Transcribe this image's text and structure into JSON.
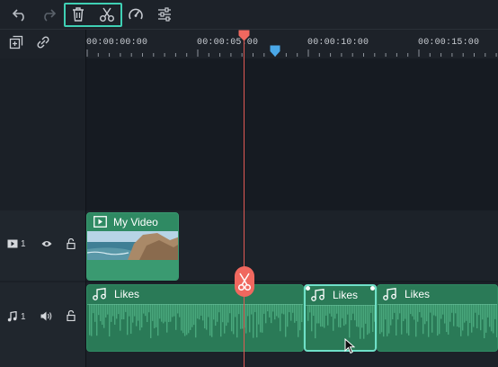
{
  "toolbar": {
    "buttons": [
      {
        "name": "undo-icon",
        "enabled": true
      },
      {
        "name": "redo-icon",
        "enabled": false
      },
      {
        "name": "delete-icon",
        "enabled": true
      },
      {
        "name": "scissors-icon",
        "enabled": true
      },
      {
        "name": "speed-icon",
        "enabled": true
      },
      {
        "name": "adjust-icon",
        "enabled": true
      }
    ],
    "highlight_color": "#3fd0b4"
  },
  "left_tools": [
    "add-track-icon",
    "link-icon"
  ],
  "ruler": {
    "labels": [
      "00:00:00:00",
      "00:00:05:00",
      "00:00:10:00",
      "00:00:15:00"
    ]
  },
  "tracks": {
    "video": {
      "number": "1",
      "icons": [
        "video-track-icon",
        "eye-icon",
        "unlock-icon"
      ]
    },
    "audio": {
      "number": "1",
      "icons": [
        "music-track-icon",
        "volume-icon",
        "unlock-icon"
      ]
    }
  },
  "clips": {
    "video": {
      "title": "My Video"
    },
    "audio": [
      {
        "title": "Likes",
        "selected": false
      },
      {
        "title": "Likes",
        "selected": true
      },
      {
        "title": "Likes",
        "selected": false
      }
    ]
  },
  "colors": {
    "playhead": "#e05a54",
    "marker": "#4aa8e8",
    "clip_green": "#2a7a57",
    "selection": "#6fe0c8"
  }
}
